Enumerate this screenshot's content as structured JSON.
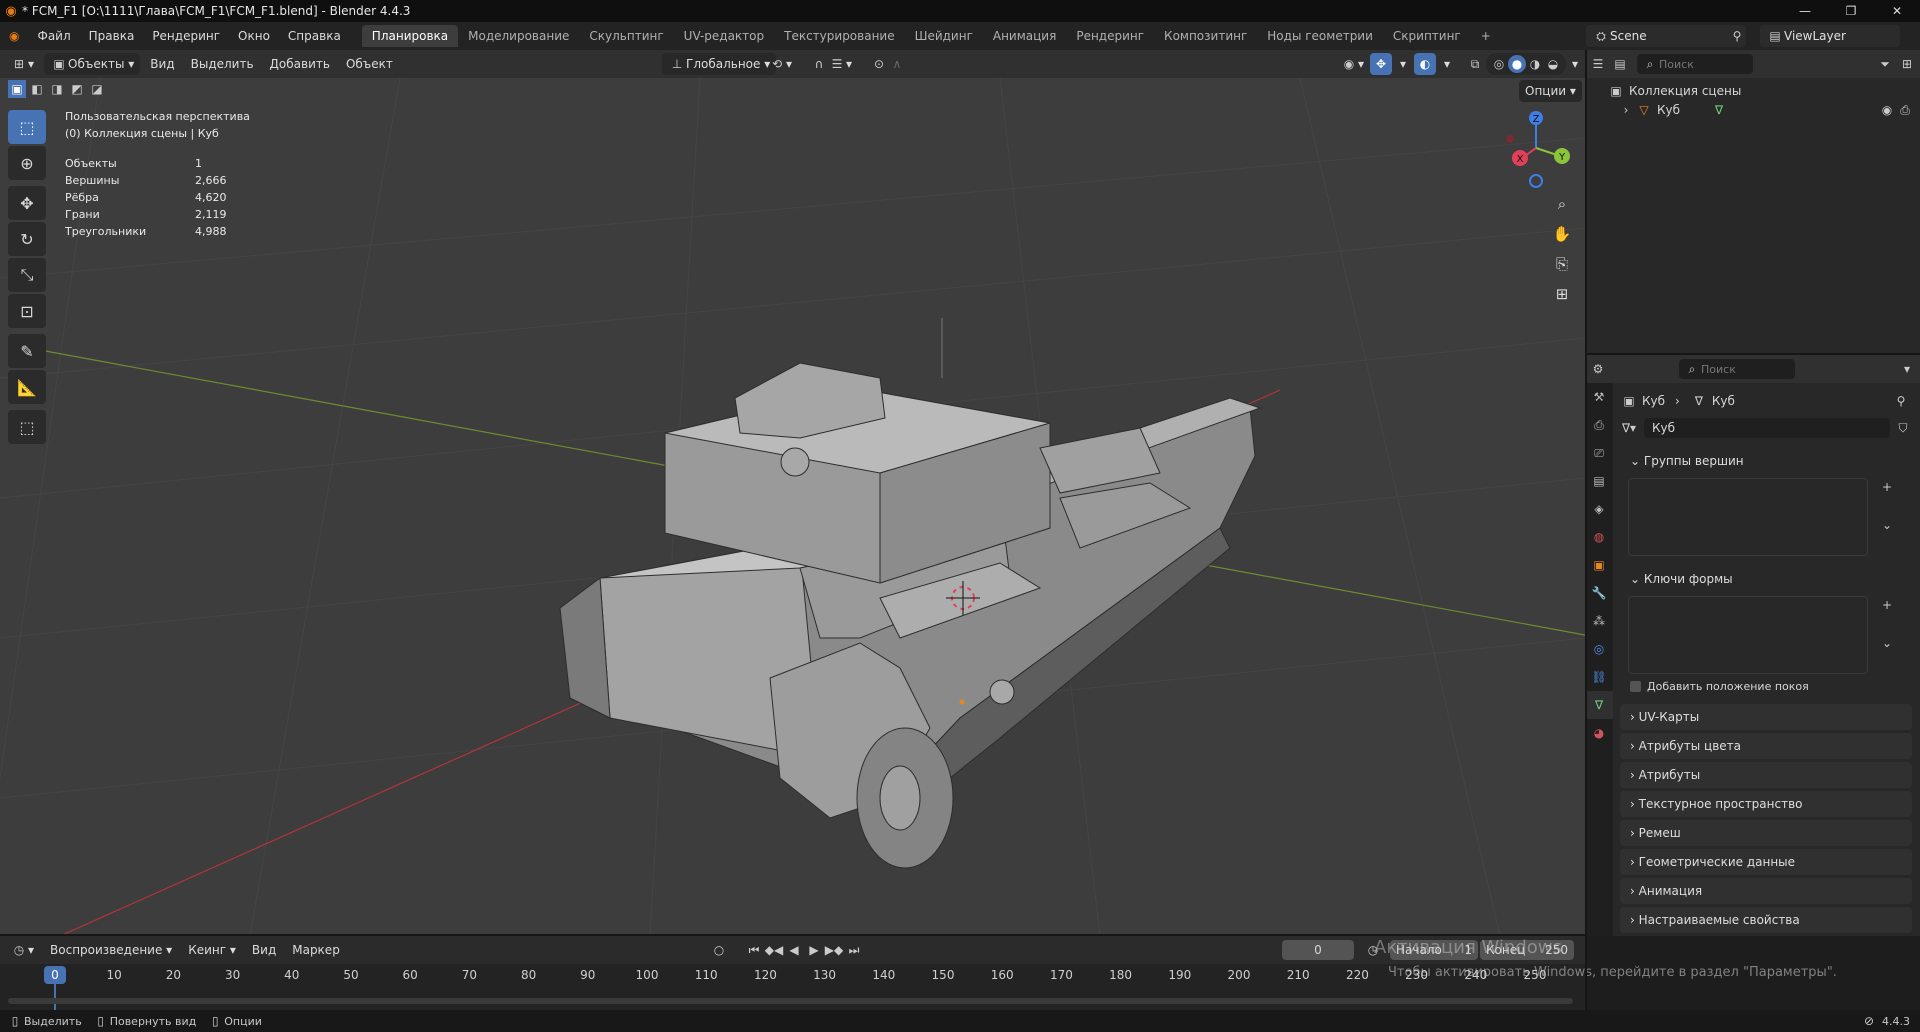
{
  "window": {
    "title": "* FCM_F1 [O:\\1111\\Глава\\FCM_F1\\FCM_F1.blend] - Blender 4.4.3",
    "controls": [
      "—",
      "❐",
      "✕"
    ]
  },
  "menu": [
    "Файл",
    "Правка",
    "Рендеринг",
    "Окно",
    "Справка"
  ],
  "workspaces": [
    "Планировка",
    "Моделирование",
    "Скульптинг",
    "UV-редактор",
    "Текстурирование",
    "Шейдинг",
    "Анимация",
    "Рендеринг",
    "Композитинг",
    "Ноды геометрии",
    "Скриптинг"
  ],
  "workspace_add": "+",
  "scene": {
    "name": "Scene",
    "view_layer": "ViewLayer"
  },
  "viewport_header": {
    "mode": "Объекты",
    "menus": [
      "Вид",
      "Выделить",
      "Добавить",
      "Объект"
    ],
    "orientation": "Глобальное",
    "options": "Опции"
  },
  "viewport": {
    "view_name": "Пользовательская перспектива",
    "collection_line": "(0) Коллекция сцены | Куб",
    "stats": [
      {
        "label": "Объекты",
        "value": "1"
      },
      {
        "label": "Вершины",
        "value": "2,666"
      },
      {
        "label": "Рёбра",
        "value": "4,620"
      },
      {
        "label": "Грани",
        "value": "2,119"
      },
      {
        "label": "Треугольники",
        "value": "4,988"
      }
    ],
    "gizmo": {
      "x": "X",
      "y": "Y",
      "z": "Z"
    }
  },
  "outliner": {
    "search_placeholder": "Поиск",
    "collection": "Коллекция сцены",
    "object": "Куб"
  },
  "properties": {
    "search_placeholder": "Поиск",
    "breadcrumb": [
      "Куб",
      "Куб"
    ],
    "data_name": "Куб",
    "vertex_groups": "Группы вершин",
    "shape_keys": "Ключи формы",
    "add_rest_position": "Добавить положение покоя",
    "panels": [
      "UV-Карты",
      "Атрибуты цвета",
      "Атрибуты",
      "Текстурное пространство",
      "Ремеш",
      "Геометрические данные",
      "Анимация",
      "Настраиваемые свойства"
    ]
  },
  "timeline": {
    "menus": [
      "Воспроизведение",
      "Кеинг",
      "Вид",
      "Маркер"
    ],
    "current_frame": "0",
    "start_label": "Начало",
    "start_value": "1",
    "end_label": "Конец",
    "end_value": "250",
    "ticks": [
      "0",
      "10",
      "20",
      "30",
      "40",
      "50",
      "60",
      "70",
      "80",
      "90",
      "100",
      "110",
      "120",
      "130",
      "140",
      "150",
      "160",
      "170",
      "180",
      "190",
      "200",
      "210",
      "220",
      "230",
      "240",
      "250"
    ]
  },
  "watermark": {
    "line1": "Активация Windows",
    "line2": "Чтобы активировать Windows, перейдите в раздел \"Параметры\"."
  },
  "status": {
    "select": "Выделить",
    "rotate": "Повернуть вид",
    "options": "Опции",
    "version": "4.4.3"
  },
  "colors": {
    "accent": "#4772b3",
    "viewport_bg": "#3d3d3d",
    "axis_x": "#e0405a",
    "axis_y": "#8bc33a",
    "axis_z": "#3f7ee8"
  }
}
